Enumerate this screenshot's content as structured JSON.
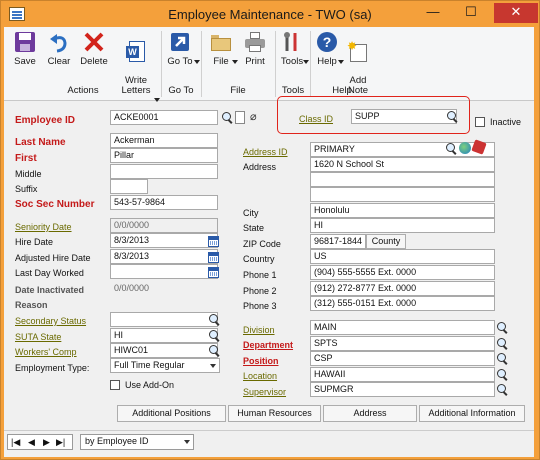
{
  "window": {
    "title": "Employee Maintenance  -  TWO (sa)",
    "min": "—",
    "max": "☐",
    "close": "✕"
  },
  "ribbon": {
    "buttons": [
      {
        "id": "save",
        "label": "Save",
        "icon": "save-icon"
      },
      {
        "id": "clear",
        "label": "Clear",
        "icon": "undo-arrow-icon"
      },
      {
        "id": "delete",
        "label": "Delete",
        "icon": "red-x-icon"
      },
      {
        "id": "write",
        "label": "Write\nLetters",
        "icon": "word-doc-icon"
      },
      {
        "id": "goto",
        "label": "Go To",
        "icon": "go-arrow-icon"
      },
      {
        "id": "file",
        "label": "File",
        "icon": "folder-icon"
      },
      {
        "id": "print",
        "label": "Print",
        "icon": "printer-icon"
      },
      {
        "id": "tools",
        "label": "Tools",
        "icon": "tools-icon"
      },
      {
        "id": "help",
        "label": "Help",
        "icon": "help-icon"
      },
      {
        "id": "addnote",
        "label": "Add\nNote",
        "icon": "add-note-icon"
      }
    ],
    "groups": {
      "actions": "Actions",
      "goto": "Go To",
      "file": "File",
      "tools": "Tools",
      "help": "Help"
    }
  },
  "form": {
    "employee_id": {
      "label": "Employee ID",
      "value": "ACKE0001"
    },
    "class_id": {
      "label": "Class ID",
      "value": "SUPP"
    },
    "inactive": {
      "label": "Inactive",
      "checked": false
    },
    "last_name": {
      "label": "Last Name",
      "value": "Ackerman"
    },
    "first": {
      "label": "First",
      "value": "Pillar"
    },
    "middle": {
      "label": "Middle",
      "value": ""
    },
    "suffix": {
      "label": "Suffix",
      "value": ""
    },
    "ssn": {
      "label": "Soc Sec Number",
      "value": "543-57-9864"
    },
    "seniority_date": {
      "label": "Seniority Date",
      "value": "0/0/0000"
    },
    "hire_date": {
      "label": "Hire Date",
      "value": "8/3/2013"
    },
    "adj_hire_date": {
      "label": "Adjusted Hire Date",
      "value": "8/3/2013"
    },
    "last_day": {
      "label": "Last Day Worked",
      "value": ""
    },
    "date_inactivated": {
      "label": "Date Inactivated",
      "value": "0/0/0000"
    },
    "reason": {
      "label": "Reason",
      "value": ""
    },
    "secondary_status": {
      "label": "Secondary Status",
      "value": ""
    },
    "suta_state": {
      "label": "SUTA State",
      "value": "HI"
    },
    "workers_comp": {
      "label": "Workers' Comp",
      "value": "HIWC01"
    },
    "employment_type": {
      "label": "Employment Type:",
      "value": "Full Time Regular"
    },
    "use_addon": {
      "label": "Use Add-On",
      "checked": false
    },
    "address_id": {
      "label": "Address ID",
      "value": "PRIMARY"
    },
    "address": {
      "label": "Address",
      "lines": [
        "1620 N School St",
        "",
        ""
      ]
    },
    "city": {
      "label": "City",
      "value": "Honolulu"
    },
    "state": {
      "label": "State",
      "value": "HI"
    },
    "zip": {
      "label": "ZIP Code",
      "value": "96817-1844",
      "county_button": "County"
    },
    "country": {
      "label": "Country",
      "value": "US"
    },
    "phone1": {
      "label": "Phone 1",
      "value": "(904) 555-5555  Ext. 0000"
    },
    "phone2": {
      "label": "Phone 2",
      "value": "(912) 272-8777  Ext. 0000"
    },
    "phone3": {
      "label": "Phone 3",
      "value": "(312) 555-0151  Ext. 0000"
    },
    "division": {
      "label": "Division",
      "value": "MAIN"
    },
    "department": {
      "label": "Department",
      "value": "SPTS"
    },
    "position": {
      "label": "Position",
      "value": "CSP"
    },
    "location": {
      "label": "Location",
      "value": "HAWAII"
    },
    "supervisor": {
      "label": "Supervisor",
      "value": "SUPMGR"
    }
  },
  "buttons": {
    "additional_positions": "Additional Positions",
    "human_resources": "Human Resources",
    "address": "Address",
    "additional_info": "Additional Information"
  },
  "footer": {
    "sort": "by Employee ID"
  }
}
